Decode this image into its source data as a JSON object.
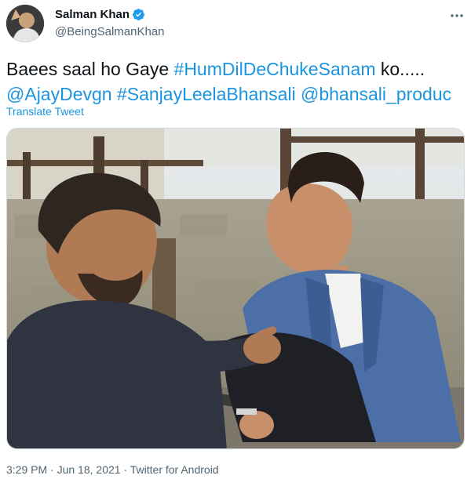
{
  "author": {
    "display_name": "Salman Khan",
    "handle": "@BeingSalmanKhan",
    "verified": true
  },
  "tweet": {
    "text_parts": [
      {
        "text": "Baees saal ho Gaye ",
        "type": "plain"
      },
      {
        "text": "#HumDilDeChukeSanam",
        "type": "link"
      },
      {
        "text": " ko.....",
        "type": "plain"
      },
      {
        "text": "@AjayDevgn",
        "type": "link"
      },
      {
        "text": " ",
        "type": "plain"
      },
      {
        "text": "#SanjayLeelaBhansali",
        "type": "link"
      },
      {
        "text": " ",
        "type": "plain"
      },
      {
        "text": "@bhansali_produc",
        "type": "link"
      }
    ],
    "translate_label": "Translate Tweet"
  },
  "meta": {
    "time": "3:29 PM",
    "date": "Jun 18, 2021",
    "source": "Twitter for Android",
    "separator": "·"
  },
  "colors": {
    "link": "#1b95e0",
    "verified": "#1d9bf0",
    "secondary": "#536471"
  },
  "icons": {
    "verified": "verified-badge-icon",
    "more": "more-horizontal-icon"
  }
}
